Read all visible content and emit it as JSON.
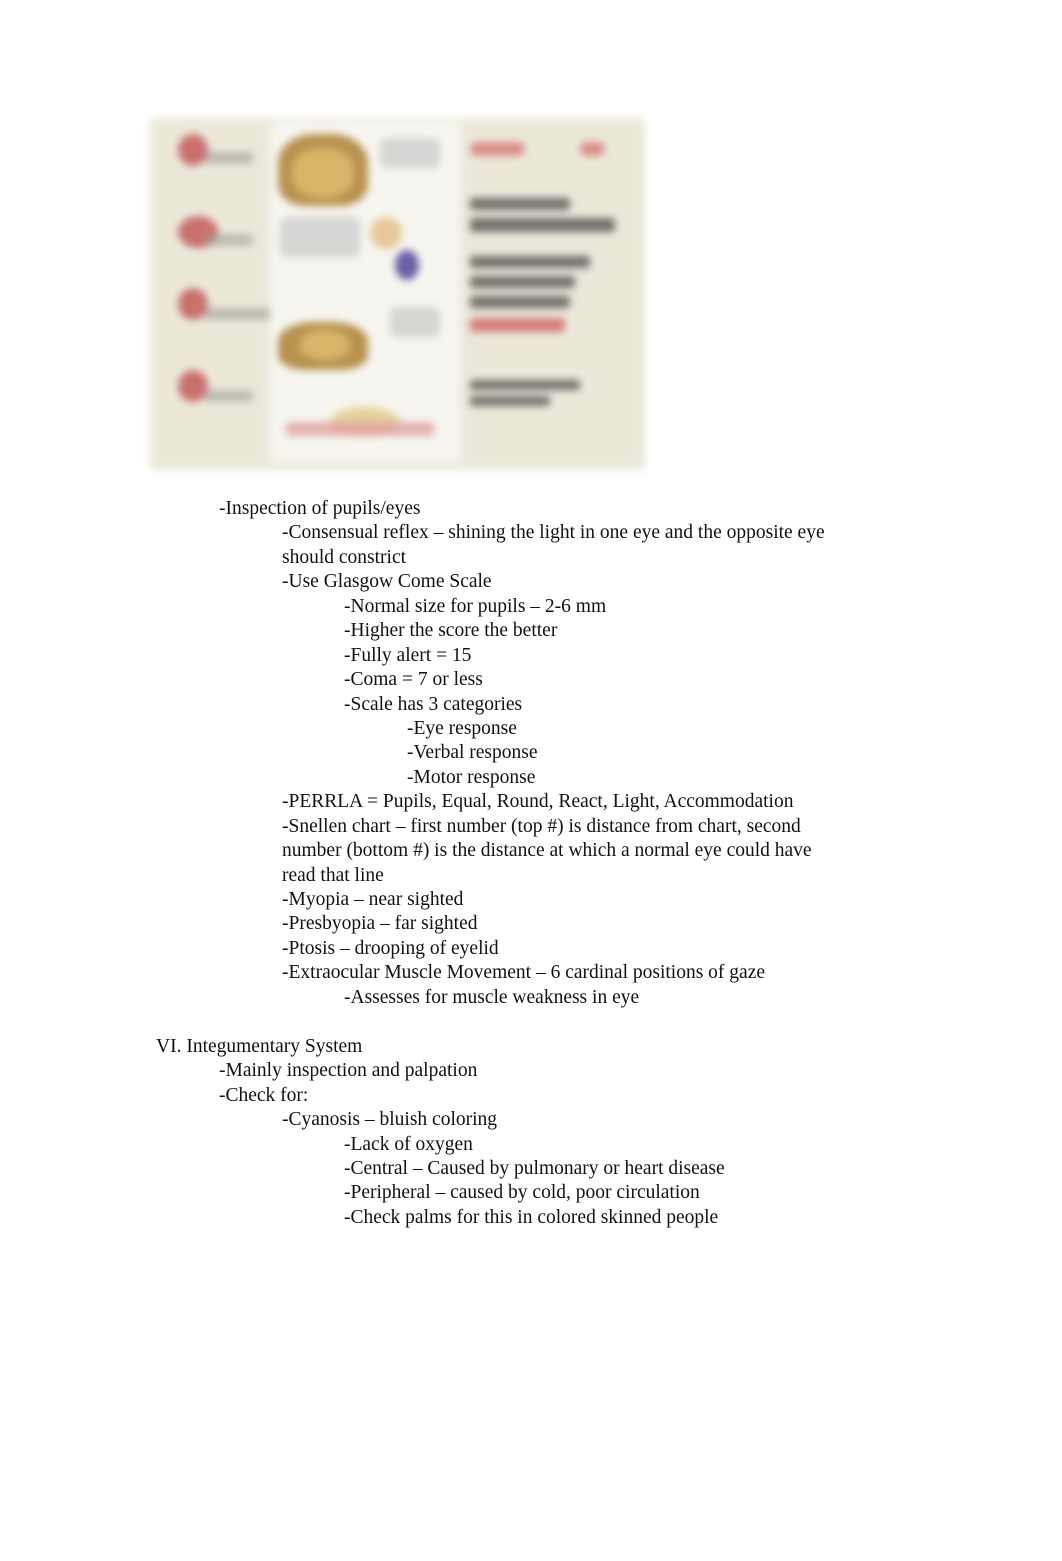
{
  "figure": {
    "description": "Blurred embedded illustration (pupil/eye assessment graphic)",
    "colors": {
      "background": "#ebe8da",
      "accent_red": "#c45a5a",
      "face": "#b8924f",
      "purple": "#6a5ea8"
    }
  },
  "lines": [
    {
      "level": 1,
      "text": "-Inspection of pupils/eyes"
    },
    {
      "level": 2,
      "text": "-Consensual reflex – shining the light in one eye and the opposite eye"
    },
    {
      "level": 2,
      "text": "should constrict"
    },
    {
      "level": 2,
      "text": "-Use Glasgow Come Scale"
    },
    {
      "level": 3,
      "text": "-Normal size for pupils – 2-6 mm"
    },
    {
      "level": 3,
      "text": "-Higher the score the better"
    },
    {
      "level": 3,
      "text": "-Fully alert = 15"
    },
    {
      "level": 3,
      "text": "-Coma = 7 or less"
    },
    {
      "level": 3,
      "text": "-Scale has 3 categories"
    },
    {
      "level": 4,
      "text": "-Eye response"
    },
    {
      "level": 4,
      "text": "-Verbal response"
    },
    {
      "level": 4,
      "text": "-Motor response"
    },
    {
      "level": 2,
      "text": "-PERRLA = Pupils, Equal, Round, React, Light, Accommodation"
    },
    {
      "level": 2,
      "text": "-Snellen chart – first number (top #) is distance from chart, second"
    },
    {
      "level": 2,
      "text": "number (bottom #) is the distance at which a normal eye could have"
    },
    {
      "level": 2,
      "text": "read that line"
    },
    {
      "level": 2,
      "text": "-Myopia – near sighted"
    },
    {
      "level": 2,
      "text": "-Presbyopia – far sighted"
    },
    {
      "level": 2,
      "text": "-Ptosis – drooping of eyelid"
    },
    {
      "level": 2,
      "text": "-Extraocular Muscle Movement – 6 cardinal positions of gaze"
    },
    {
      "level": 3,
      "text": "-Assesses for muscle weakness in eye"
    },
    {
      "level": 0,
      "text": "VI. Integumentary System"
    },
    {
      "level": 1,
      "text": "-Mainly inspection and palpation"
    },
    {
      "level": 1,
      "text": "-Check for:"
    },
    {
      "level": 2,
      "text": "-Cyanosis – bluish coloring"
    },
    {
      "level": 3,
      "text": "-Lack of oxygen"
    },
    {
      "level": 3,
      "text": "-Central – Caused by pulmonary or heart disease"
    },
    {
      "level": 3,
      "text": "-Peripheral – caused by cold, poor circulation"
    },
    {
      "level": 3,
      "text": "-Check palms for this in colored skinned people"
    }
  ]
}
